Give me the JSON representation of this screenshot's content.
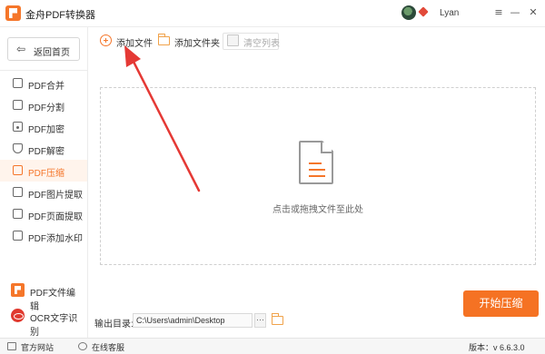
{
  "window": {
    "title": "金舟PDF转换器",
    "username": "Lyan",
    "buttons": {
      "menu": "≡",
      "minimize": "—",
      "close": "✕"
    }
  },
  "sidebar": {
    "back_label": "返回首页",
    "items": [
      {
        "label": "PDF合并",
        "icon": "merge-icon",
        "active": false
      },
      {
        "label": "PDF分割",
        "icon": "split-icon",
        "active": false
      },
      {
        "label": "PDF加密",
        "icon": "lock-icon",
        "active": false
      },
      {
        "label": "PDF解密",
        "icon": "shield-icon",
        "active": false
      },
      {
        "label": "PDF压缩",
        "icon": "compress-icon",
        "active": true
      },
      {
        "label": "PDF图片提取",
        "icon": "image-extract-icon",
        "active": false
      },
      {
        "label": "PDF页面提取",
        "icon": "page-extract-icon",
        "active": false
      },
      {
        "label": "PDF添加水印",
        "icon": "watermark-icon",
        "active": false
      }
    ],
    "tools": [
      {
        "label": "PDF文件编辑",
        "icon": "pdf-logo-icon"
      },
      {
        "label": "OCR文字识别",
        "icon": "ocr-eye-icon"
      }
    ]
  },
  "toolbar": {
    "add_file": "添加文件",
    "add_folder": "添加文件夹",
    "clear_list": "清空列表"
  },
  "dropzone": {
    "hint": "点击或拖拽文件至此处"
  },
  "output": {
    "label": "输出目录:",
    "path": "C:\\Users\\admin\\Desktop",
    "browse": "···"
  },
  "actions": {
    "start": "开始压缩"
  },
  "statusbar": {
    "website": "官方网站",
    "support": "在线客服",
    "version": "版本：v 6.6.3.0"
  },
  "colors": {
    "accent": "#f57223",
    "annotation": "#e53935"
  }
}
